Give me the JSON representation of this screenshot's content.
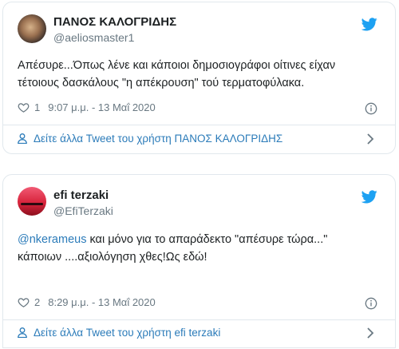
{
  "tweets": [
    {
      "name": "ΠΑΝΟΣ ΚΑΛΟΓΡΙΔΗΣ",
      "handle": "@aeliosmaster1",
      "text_line1": "Απέσυρε...Όπως λένε και κάποιοι δημοσιογράφοι οίτινες είχαν",
      "text_line2": "τέτοιους δασκάλους \"η απέκρουση\" τού τερματοφύλακα.",
      "likes": "1",
      "time": "9:07 μ.μ. - 13 Μαΐ 2020",
      "more_link": "Δείτε άλλα Tweet του χρήστη ΠΑΝΟΣ ΚΑΛΟΓΡΙΔΗΣ"
    },
    {
      "name": "efi terzaki",
      "handle": "@EfiTerzaki",
      "mention": "@nkerameus",
      "text_line1_rest": " και μόνο για το απαράδεκτο \"απέσυρε τώρα...\"",
      "text_line2": "κάποιων ....αξιολόγηση χθες!Ως εδώ!",
      "likes": "2",
      "time": "8:29 μ.μ. - 13 Μαΐ 2020",
      "more_link": "Δείτε άλλα Tweet του χρήστη efi terzaki"
    }
  ],
  "icons": {
    "twitter": "twitter-bird-icon",
    "like": "heart-icon",
    "info": "info-icon",
    "user": "user-icon",
    "chevron": "chevron-right-icon"
  },
  "colors": {
    "twitter_blue": "#1da1f2",
    "link_blue": "#2b7bb9",
    "muted": "#697882",
    "border": "#e1e8ed"
  }
}
